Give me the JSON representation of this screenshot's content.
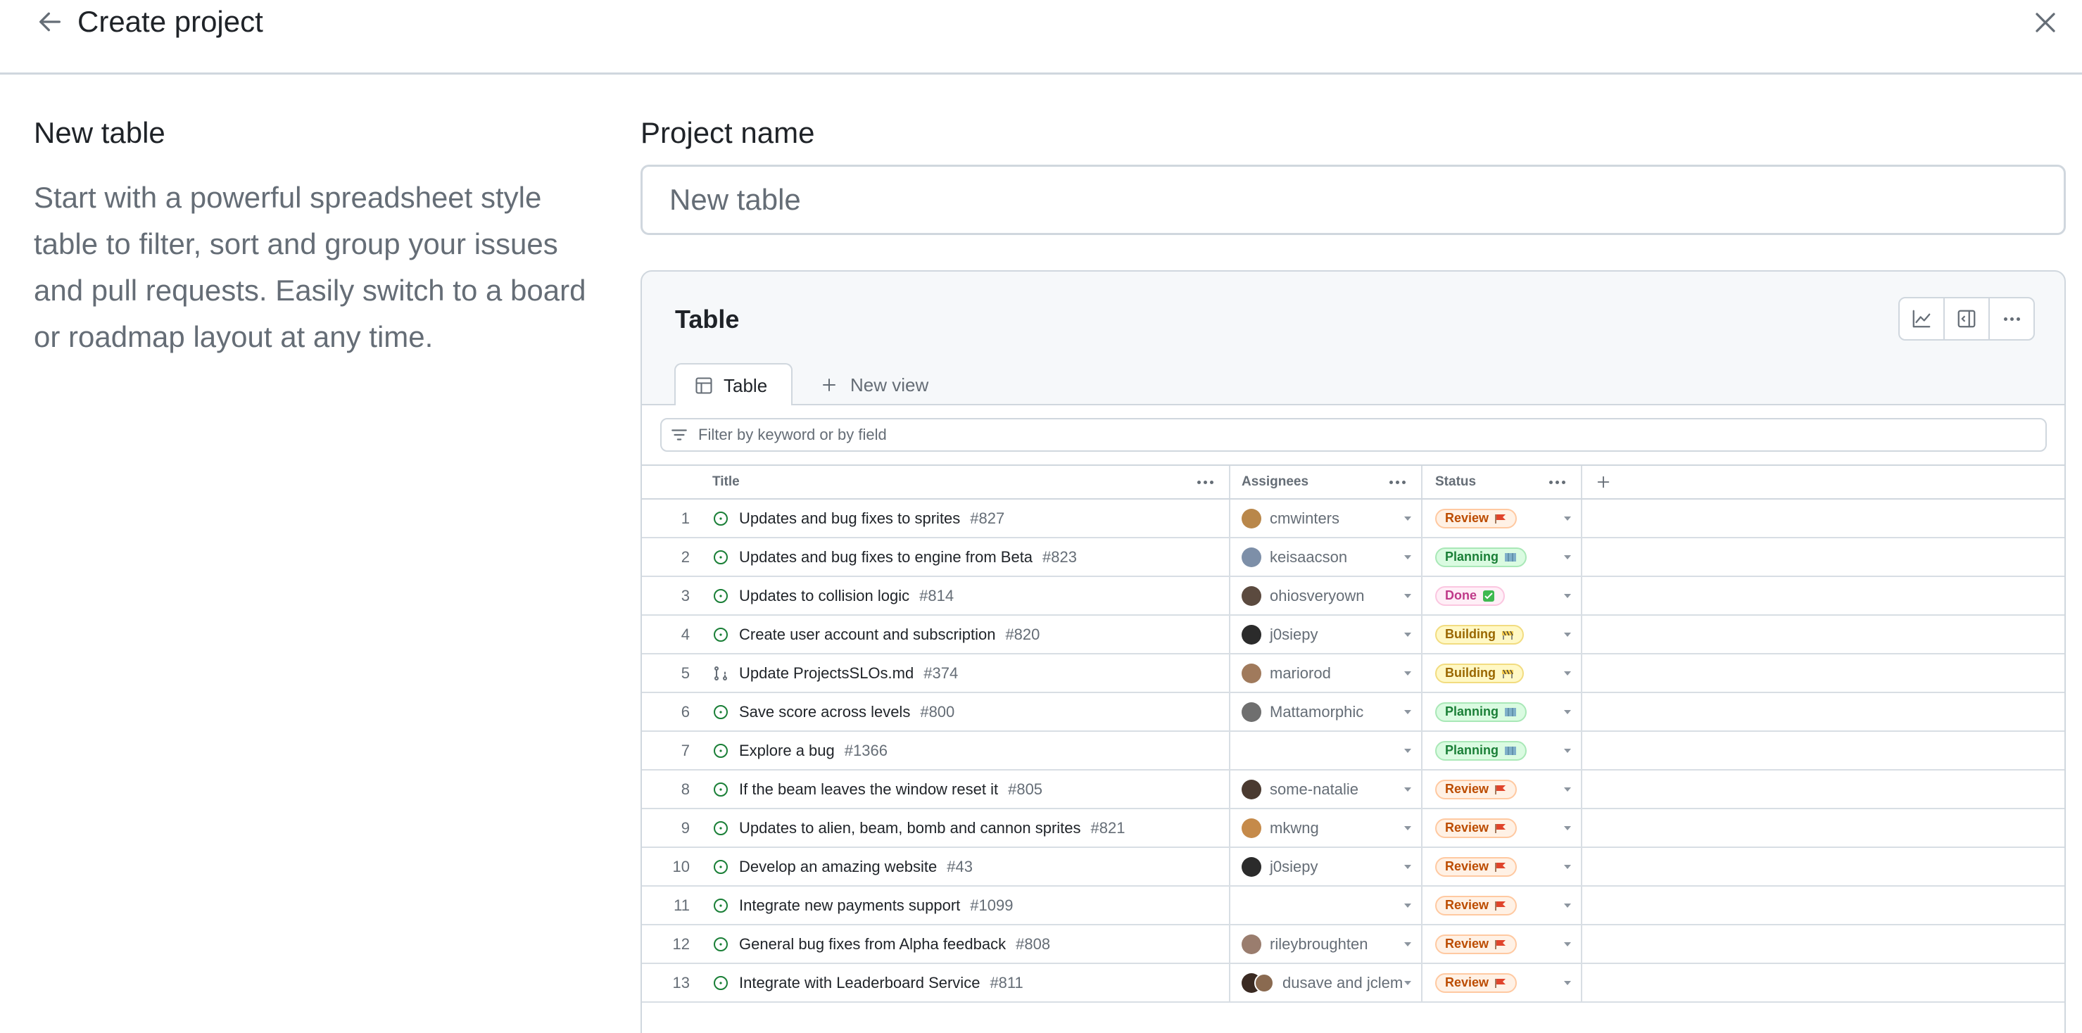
{
  "header": {
    "title": "Create project"
  },
  "left": {
    "title": "New table",
    "description": "Start with a powerful spreadsheet style table to filter, sort and group your issues and pull requests. Easily switch to a board or roadmap layout at any time."
  },
  "project_name": {
    "label": "Project name",
    "placeholder": "New table",
    "value": ""
  },
  "preview": {
    "title": "Table",
    "tabs": [
      {
        "label": "Table"
      }
    ],
    "new_view_label": "New view",
    "filter_placeholder": "Filter by keyword or by field",
    "columns": {
      "title": "Title",
      "assignees": "Assignees",
      "status": "Status"
    },
    "rows": [
      {
        "num": "1",
        "type": "issue",
        "title": "Updates and bug fixes to sprites",
        "issue": "#827",
        "assignee": "cmwinters",
        "avatar_color": "#b9874a",
        "status": "Review",
        "status_kind": "review"
      },
      {
        "num": "2",
        "type": "issue",
        "title": "Updates and bug fixes to engine from Beta",
        "issue": "#823",
        "assignee": "keisaacson",
        "avatar_color": "#7d8fa8",
        "status": "Planning",
        "status_kind": "planning"
      },
      {
        "num": "3",
        "type": "issue",
        "title": "Updates to collision logic",
        "issue": "#814",
        "assignee": "ohiosveryown",
        "avatar_color": "#5b4a3f",
        "status": "Done",
        "status_kind": "done"
      },
      {
        "num": "4",
        "type": "issue",
        "title": "Create user account and subscription",
        "issue": "#820",
        "assignee": "j0siepy",
        "avatar_color": "#2b2b2b",
        "status": "Building",
        "status_kind": "building"
      },
      {
        "num": "5",
        "type": "pr",
        "title": "Update ProjectsSLOs.md",
        "issue": "#374",
        "assignee": "mariorod",
        "avatar_color": "#a07a5c",
        "status": "Building",
        "status_kind": "building"
      },
      {
        "num": "6",
        "type": "issue",
        "title": "Save score across levels",
        "issue": "#800",
        "assignee": "Mattamorphic",
        "avatar_color": "#6f6f6f",
        "status": "Planning",
        "status_kind": "planning"
      },
      {
        "num": "7",
        "type": "issue",
        "title": "Explore a bug",
        "issue": "#1366",
        "assignee": "",
        "avatar_color": "",
        "status": "Planning",
        "status_kind": "planning"
      },
      {
        "num": "8",
        "type": "issue",
        "title": "If the beam leaves the window reset it",
        "issue": "#805",
        "assignee": "some-natalie",
        "avatar_color": "#4a3a30",
        "status": "Review",
        "status_kind": "review"
      },
      {
        "num": "9",
        "type": "issue",
        "title": "Updates to alien, beam, bomb and cannon sprites",
        "issue": "#821",
        "assignee": "mkwng",
        "avatar_color": "#c58a4a",
        "status": "Review",
        "status_kind": "review"
      },
      {
        "num": "10",
        "type": "issue",
        "title": "Develop an amazing website",
        "issue": "#43",
        "assignee": "j0siepy",
        "avatar_color": "#2b2b2b",
        "status": "Review",
        "status_kind": "review"
      },
      {
        "num": "11",
        "type": "issue",
        "title": "Integrate new payments support",
        "issue": "#1099",
        "assignee": "",
        "avatar_color": "",
        "status": "Review",
        "status_kind": "review"
      },
      {
        "num": "12",
        "type": "issue",
        "title": "General bug fixes from Alpha feedback",
        "issue": "#808",
        "assignee": "rileybroughten",
        "avatar_color": "#9a7d6e",
        "status": "Review",
        "status_kind": "review"
      },
      {
        "num": "13",
        "type": "issue",
        "title": "Integrate with Leaderboard Service",
        "issue": "#811",
        "assignee": "dusave and jclem",
        "avatar_color": "#3a2a22",
        "avatar_color_2": "#8a6a50",
        "status": "Review",
        "status_kind": "review"
      }
    ]
  },
  "colors": {
    "accent_green": "#1a7f37",
    "border": "#d0d7de",
    "muted_text": "#656d76"
  }
}
